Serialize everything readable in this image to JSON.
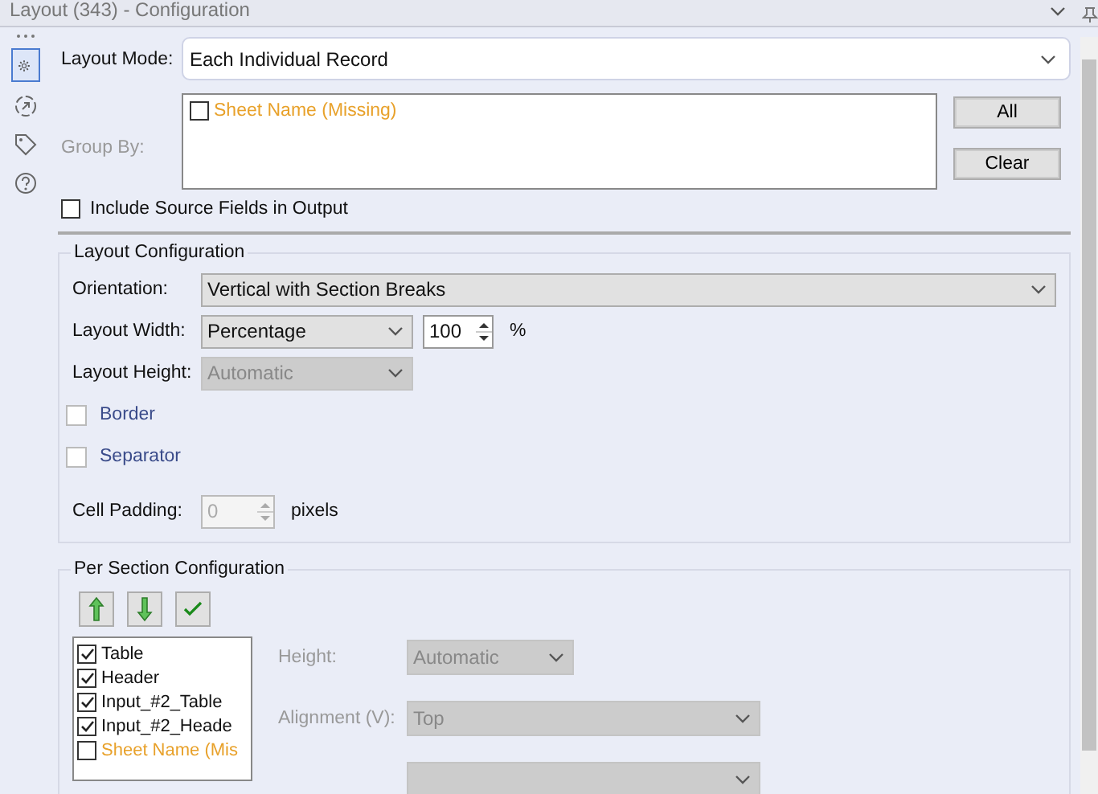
{
  "window": {
    "title": "Layout (343) - Configuration"
  },
  "sidebar": {
    "items": [
      {
        "kind": "gear",
        "selected": true
      },
      {
        "kind": "connect",
        "selected": false
      },
      {
        "kind": "tag",
        "selected": false
      },
      {
        "kind": "help",
        "selected": false
      }
    ]
  },
  "layout_mode": {
    "label": "Layout Mode:",
    "value": "Each Individual Record"
  },
  "group_by": {
    "label": "Group By:",
    "disabled": true,
    "items": [
      {
        "text": "Sheet Name (Missing)",
        "checked": false,
        "missing": true
      }
    ],
    "buttons": [
      "All",
      "Clear"
    ]
  },
  "include_source_fields": {
    "label": "Include Source Fields in Output",
    "checked": false
  },
  "layout_configuration": {
    "title": "Layout Configuration",
    "rows": [
      {
        "kind": "select",
        "label": "Orientation:",
        "value": "Vertical with Section Breaks",
        "disabled": false,
        "wide": true
      },
      {
        "kind": "select_spin",
        "label": "Layout Width:",
        "value": "Percentage",
        "disabled": false,
        "spin": "100",
        "unit": "%"
      },
      {
        "kind": "select",
        "label": "Layout Height:",
        "value": "Automatic",
        "disabled": true,
        "wide": false
      },
      {
        "kind": "check",
        "label": "Border",
        "checked": false
      },
      {
        "kind": "check",
        "label": "Separator",
        "checked": false
      },
      {
        "kind": "spin",
        "label": "Cell Padding:",
        "spin": "0",
        "disabled": true,
        "unit": "pixels"
      }
    ]
  },
  "per_section_configuration": {
    "title": "Per Section Configuration",
    "tools": [
      {
        "kind": "up"
      },
      {
        "kind": "down"
      },
      {
        "kind": "check"
      }
    ],
    "sections": [
      {
        "text": "Table",
        "checked": true,
        "missing": false
      },
      {
        "text": "Header",
        "checked": true,
        "missing": false
      },
      {
        "text": "Input_#2_Table",
        "checked": true,
        "missing": false
      },
      {
        "text": "Input_#2_Heade",
        "checked": true,
        "missing": false
      },
      {
        "text": "Sheet Name (Mis",
        "checked": false,
        "missing": true
      }
    ],
    "fields": [
      {
        "label": "Height:",
        "value": "Automatic",
        "disabled": true,
        "wide": false
      },
      {
        "label": "Alignment (V):",
        "value": "Top",
        "disabled": true,
        "wide": true
      },
      {
        "disabled": true,
        "wide": true
      }
    ]
  }
}
